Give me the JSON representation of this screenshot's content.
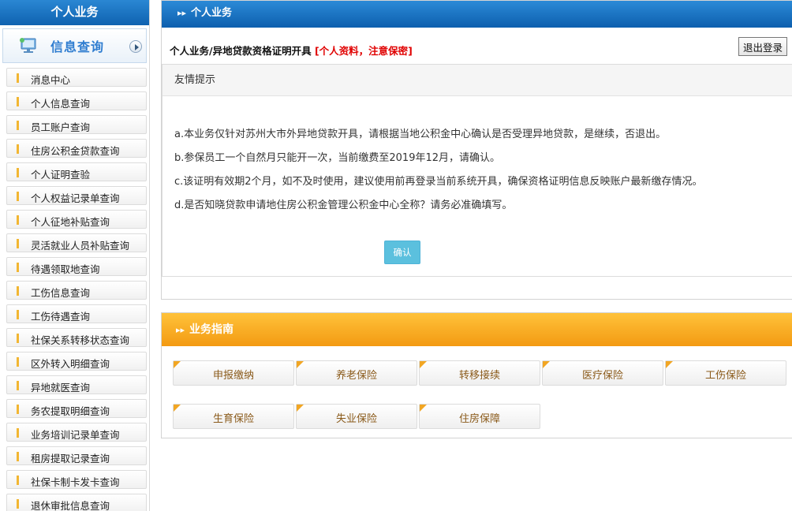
{
  "sidebar": {
    "top_title": "个人业务",
    "header_title": "信息查询",
    "items": [
      {
        "label": "消息中心"
      },
      {
        "label": "个人信息查询"
      },
      {
        "label": "员工账户查询"
      },
      {
        "label": "住房公积金贷款查询"
      },
      {
        "label": "个人证明查验"
      },
      {
        "label": "个人权益记录单查询"
      },
      {
        "label": "个人征地补贴查询"
      },
      {
        "label": "灵活就业人员补贴查询"
      },
      {
        "label": "待遇领取地查询"
      },
      {
        "label": "工伤信息查询"
      },
      {
        "label": "工伤待遇查询"
      },
      {
        "label": "社保关系转移状态查询"
      },
      {
        "label": "区外转入明细查询"
      },
      {
        "label": "异地就医查询"
      },
      {
        "label": "务农提取明细查询"
      },
      {
        "label": "业务培训记录单查询"
      },
      {
        "label": "租房提取记录查询"
      },
      {
        "label": "社保卡制卡发卡查询"
      },
      {
        "label": "退休审批信息查询"
      }
    ]
  },
  "main": {
    "section_title": "个人业务",
    "breadcrumb": "个人业务/异地贷款资格证明开具",
    "breadcrumb_warning": "[个人资料，注意保密]",
    "logout_label": "退出登录",
    "tip_title": "友情提示",
    "tips": [
      "a.本业务仅针对苏州大市外异地贷款开具，请根据当地公积金中心确认是否受理异地贷款，是继续，否退出。",
      "b.参保员工一个自然月只能开一次，当前缴费至2019年12月，请确认。",
      "c.该证明有效期2个月，如不及时使用，建议使用前再登录当前系统开具，确保资格证明信息反映账户最新缴存情况。",
      "d.是否知晓贷款申请地住房公积金管理公积金中心全称？请务必准确填写。"
    ],
    "confirm_label": "确认"
  },
  "guide": {
    "title": "业务指南",
    "items": [
      {
        "label": "申报缴纳"
      },
      {
        "label": "养老保险"
      },
      {
        "label": "转移接续"
      },
      {
        "label": "医疗保险"
      },
      {
        "label": "工伤保险"
      },
      {
        "label": "生育保险"
      },
      {
        "label": "失业保险"
      },
      {
        "label": "住房保障"
      }
    ]
  },
  "colors": {
    "primary_blue": "#0f62b0",
    "accent_orange": "#f39a12",
    "warning_red": "#e00000",
    "confirm_cyan": "#5bc0de",
    "sidebar_marker": "#f2b632"
  }
}
